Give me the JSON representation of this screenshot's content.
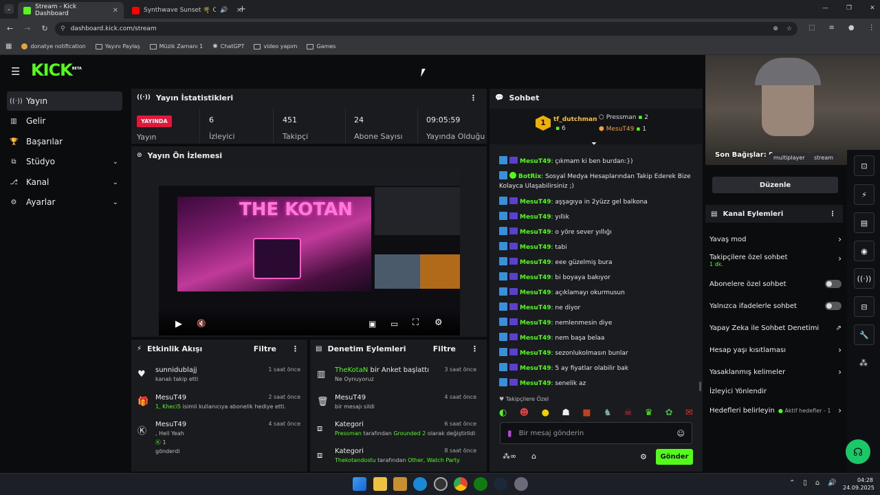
{
  "browser": {
    "tabs": [
      {
        "title": "Stream - Kick Dashboard",
        "active": true,
        "color": "#53fc18"
      },
      {
        "title": "Synthwave Sunset 🌴 Oyun",
        "active": false,
        "color": "#ff0000"
      }
    ],
    "url": "dashboard.kick.com/stream",
    "bookmarks": [
      "donatye notification",
      "Yayını Paylaş",
      "Müzik Zamanı 1",
      "ChatGPT",
      "video yapım",
      "Games"
    ]
  },
  "brand": {
    "logo": "KICK",
    "beta": "BETA",
    "accent": "#53fc18"
  },
  "sidebar": {
    "items": [
      {
        "label": "Yayın",
        "icon": "broadcast-icon",
        "active": true
      },
      {
        "label": "Gelir",
        "icon": "chart-icon"
      },
      {
        "label": "Başarılar",
        "icon": "trophy-icon"
      },
      {
        "label": "Stüdyo",
        "icon": "studio-icon",
        "expandable": true
      },
      {
        "label": "Kanal",
        "icon": "channel-icon",
        "expandable": true
      },
      {
        "label": "Ayarlar",
        "icon": "gear-icon",
        "expandable": true
      }
    ]
  },
  "stats": {
    "title": "Yayın İstatistikleri",
    "live_badge": "YAYINDA",
    "live_label": "Yayın",
    "items": [
      {
        "value": "6",
        "label": "İzleyici"
      },
      {
        "value": "451",
        "label": "Takipçi"
      },
      {
        "value": "24",
        "label": "Abone Sayısı"
      },
      {
        "value": "09:05:59",
        "label": "Yayında Olduğu"
      }
    ]
  },
  "preview": {
    "title": "Yayın Ön İzlemesi",
    "overlay_text": "THE KOTAN"
  },
  "activity": {
    "title": "Etkinlik Akışı",
    "filter": "Filtre",
    "items": [
      {
        "name": "sunnidublajj",
        "desc": "kanalı takip etti",
        "time": "1 saat önce",
        "icon": "heart-icon"
      },
      {
        "name": "MesuT49",
        "desc_hl": "1, Kheci5",
        "desc": " isimli kullanıcıya abonelik hediye etti.",
        "time": "2 saat önce",
        "icon": "gift-icon"
      },
      {
        "name": "MesuT49",
        "desc_hl": ", Hell Yeah",
        "desc": "1",
        "desc2": "gönderdi",
        "time": "4 saat önce",
        "icon": "kick-coin-icon"
      }
    ]
  },
  "moderation": {
    "title": "Denetim Eylemleri",
    "filter": "Filtre",
    "items": [
      {
        "name": "TheKotaN",
        "name_rest": " bir Anket başlattı",
        "desc": "Ne Oynuyoruz",
        "time": "3 saat önce",
        "icon": "poll-icon"
      },
      {
        "name": "MesuT49",
        "desc": "bir mesajı sildi",
        "time": "4 saat önce",
        "icon": "trash-icon"
      },
      {
        "name": "Kategori",
        "desc_hl": "Pressman",
        "desc": " tarafından ",
        "desc_hl2": "Grounded 2",
        "desc_end": " olarak değiştirildi",
        "time": "6 saat önce",
        "icon": "category-icon"
      },
      {
        "name": "Kategori",
        "desc_hl": "Thekotandostu",
        "desc": " tarafından ",
        "desc_hl2": "Other, Watch Party",
        "desc_end": "",
        "time": "8 saat önce",
        "icon": "category-icon"
      }
    ]
  },
  "chat": {
    "title": "Sohbet",
    "leaders": [
      {
        "rank": "1",
        "name": "tf_dutchman",
        "count": "6"
      },
      {
        "name": "Pressman",
        "count": "2"
      },
      {
        "name": "MesuT49",
        "count": "1"
      }
    ],
    "messages": [
      {
        "user": "MesuT49",
        "text": "çıkmam ki ben burdan:})"
      },
      {
        "user": "BotRix",
        "text": "Sosyal Medya Hesaplarından Takip Ederek Bize Kolayca Ulaşabilirsiniz ;)",
        "bot": true
      },
      {
        "user": "MesuT49",
        "text": "aşşagıya in 2yüzz gel balkona"
      },
      {
        "user": "MesuT49",
        "text": "yıllık"
      },
      {
        "user": "MesuT49",
        "text": "o yöre sever yıllığı"
      },
      {
        "user": "MesuT49",
        "text": "tabi"
      },
      {
        "user": "MesuT49",
        "text": "eee güzelmiş bura"
      },
      {
        "user": "MesuT49",
        "text": "bi boyaya bakıyor"
      },
      {
        "user": "MesuT49",
        "text": "açıklamayı okurmusun"
      },
      {
        "user": "MesuT49",
        "text": "ne diyor"
      },
      {
        "user": "MesuT49",
        "text": "nemlenmesin diye"
      },
      {
        "user": "MesuT49",
        "text": "nem başa belaa"
      },
      {
        "user": "MesuT49",
        "text": "sezonlukolmasın bunlar"
      },
      {
        "user": "MesuT49",
        "text": "5 ay fiyatlar olabilir bak"
      },
      {
        "user": "MesuT49",
        "text": "senelik az"
      }
    ],
    "followers_only": "Takipçilere Özel",
    "input_placeholder": "Bir mesaj gönderin",
    "send": "Gönder"
  },
  "channel_actions": {
    "overlay_label": "Son Bağışlar: 9",
    "tags": [
      "multiplayer",
      "stream"
    ],
    "edit": "Düzenle",
    "title": "Kanal Eylemleri",
    "items": [
      {
        "label": "Yavaş mod",
        "type": "arrow"
      },
      {
        "label": "Takipçilere özel sohbet",
        "sub": "1 dk.",
        "type": "arrow"
      },
      {
        "label": "Abonelere özel sohbet",
        "type": "toggle"
      },
      {
        "label": "Yalnızca ifadelerle sohbet",
        "type": "toggle"
      },
      {
        "label": "Yapay Zeka ile Sohbet Denetimi",
        "type": "external"
      },
      {
        "label": "Hesap yaşı kısıtlaması",
        "type": "arrow"
      },
      {
        "label": "Yasaklanmış kelimeler",
        "type": "arrow"
      },
      {
        "label": "İzleyici Yönlendir",
        "type": "none"
      },
      {
        "label": "Hedefleri belirleyin",
        "sub": "Aktif hedefler - 1",
        "type": "arrow"
      }
    ]
  },
  "taskbar": {
    "time": "04:28",
    "date": "24.09.2025"
  }
}
